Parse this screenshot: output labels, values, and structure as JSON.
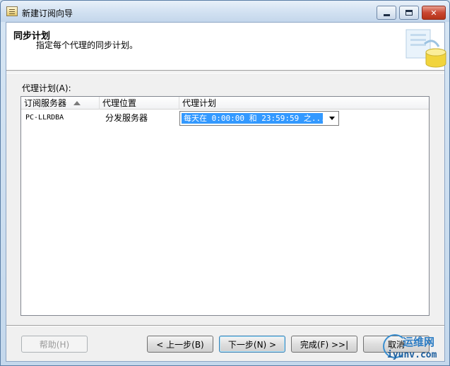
{
  "window": {
    "title": "新建订阅向导",
    "controls": {
      "minimize": "minimize-icon",
      "maximize": "maximize-icon",
      "close": "✕"
    }
  },
  "header": {
    "title": "同步计划",
    "subtitle": "指定每个代理的同步计划。",
    "art_icon": "database-sync-icon"
  },
  "grid": {
    "label": "代理计划(A):",
    "columns": [
      "订阅服务器",
      "代理位置",
      "代理计划"
    ],
    "sort_column": "订阅服务器",
    "rows": [
      {
        "subscriber": "PC-LLRDBA",
        "location": "分发服务器",
        "schedule": "每天在 0:00:00 和 23:59:59 之..."
      }
    ]
  },
  "buttons": {
    "help": "帮助(H)",
    "back": "< 上一步(B)",
    "next": "下一步(N) >",
    "finish": "完成(F) >>|",
    "cancel": "取消"
  },
  "watermark": {
    "top": "运维网",
    "bottom": "iyunv.com"
  },
  "colors": {
    "selection": "#3399ff",
    "accent": "#2b7cc4"
  }
}
